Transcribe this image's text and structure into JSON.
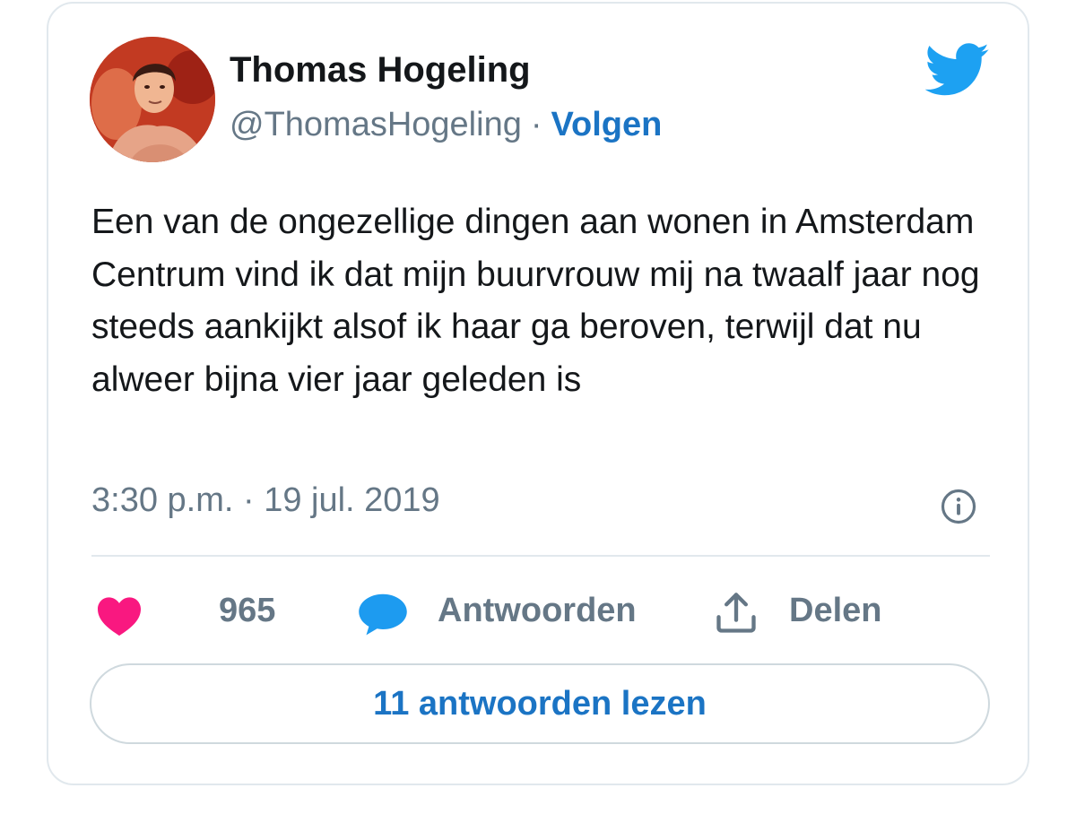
{
  "tweet": {
    "author": {
      "name": "Thomas Hogeling",
      "handle": "@ThomasHogeling",
      "separator": "·",
      "follow_label": "Volgen"
    },
    "text": "Een van de ongezellige dingen aan wonen in Amsterdam Centrum vind ik dat mijn buurvrouw mij na twaalf jaar nog steeds aankijkt alsof ik haar ga beroven, terwijl dat nu alweer bijna vier jaar geleden is",
    "timestamp": "3:30 p.m. · 19 jul. 2019"
  },
  "actions": {
    "like_count": "965",
    "reply_label": "Antwoorden",
    "share_label": "Delen"
  },
  "read_replies_label": "11 antwoorden lezen",
  "icons": {
    "brand": "twitter-bird-icon",
    "info": "info-icon",
    "like": "heart-icon",
    "reply": "speech-bubble-icon",
    "share": "share-upload-icon"
  },
  "colors": {
    "twitter_blue": "#1da1f2",
    "link_blue": "#1b74c4",
    "like_pink": "#f91880",
    "text_primary": "#14171a",
    "text_secondary": "#657786",
    "border": "#e1e8ed"
  }
}
